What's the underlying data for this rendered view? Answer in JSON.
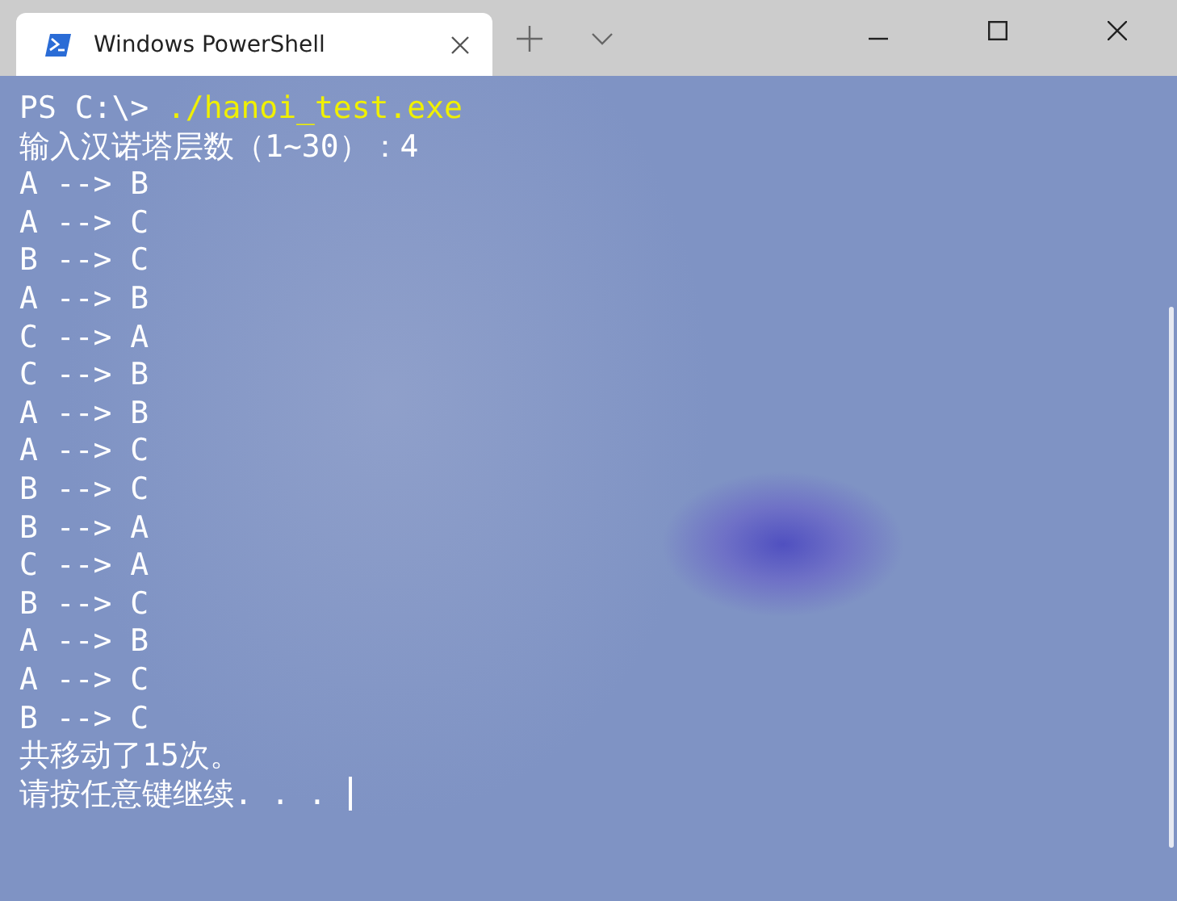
{
  "window": {
    "tab": {
      "title": "Windows PowerShell",
      "selected": true
    }
  },
  "terminal": {
    "lines": [
      {
        "kind": "command",
        "prompt": "PS C:\\>",
        "command": "./hanoi_test.exe"
      },
      {
        "kind": "output",
        "text": "输入汉诺塔层数（1~30）：4"
      },
      {
        "kind": "output",
        "text": "A --> B"
      },
      {
        "kind": "output",
        "text": "A --> C"
      },
      {
        "kind": "output",
        "text": "B --> C"
      },
      {
        "kind": "output",
        "text": "A --> B"
      },
      {
        "kind": "output",
        "text": "C --> A"
      },
      {
        "kind": "output",
        "text": "C --> B"
      },
      {
        "kind": "output",
        "text": "A --> B"
      },
      {
        "kind": "output",
        "text": "A --> C"
      },
      {
        "kind": "output",
        "text": "B --> C"
      },
      {
        "kind": "output",
        "text": "B --> A"
      },
      {
        "kind": "output",
        "text": "C --> A"
      },
      {
        "kind": "output",
        "text": "B --> C"
      },
      {
        "kind": "output",
        "text": "A --> B"
      },
      {
        "kind": "output",
        "text": "A --> C"
      },
      {
        "kind": "output",
        "text": "B --> C"
      },
      {
        "kind": "output",
        "text": "共移动了15次。"
      },
      {
        "kind": "input",
        "text": "请按任意键继续. . ."
      }
    ]
  }
}
